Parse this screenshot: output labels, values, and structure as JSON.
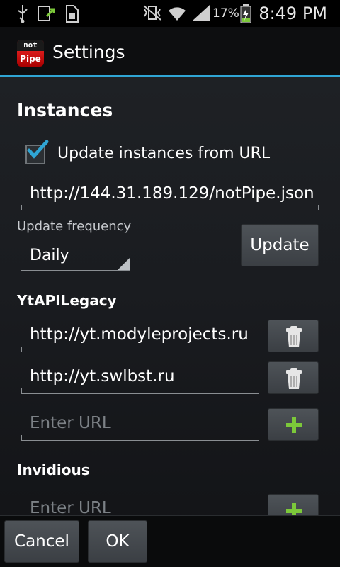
{
  "status_bar": {
    "time": "8:49 PM",
    "battery_percent": "17%",
    "icons": [
      "usb-icon",
      "download-icon",
      "sd-card-icon",
      "vibrate-mute-icon",
      "wifi-icon",
      "signal-icon",
      "battery-charging-icon"
    ]
  },
  "app": {
    "logo_top": "not",
    "logo_bottom": "Pipe",
    "title": "Settings"
  },
  "instances": {
    "header": "Instances",
    "checkbox_label": "Update instances from URL",
    "checkbox_checked": true,
    "url_value": "http://144.31.189.129/notPipe.json",
    "frequency_label": "Update frequency",
    "frequency_value": "Daily",
    "update_button": "Update"
  },
  "ytapilegacy": {
    "header": "YtAPILegacy",
    "urls": [
      "http://yt.modyleprojects.ru",
      "http://yt.swlbst.ru"
    ],
    "placeholder": "Enter URL"
  },
  "invidious": {
    "header": "Invidious",
    "placeholder": "Enter URL"
  },
  "dialog": {
    "cancel": "Cancel",
    "ok": "OK"
  },
  "colors": {
    "accent": "#2fa5d4",
    "add_icon": "#7cc83a"
  }
}
